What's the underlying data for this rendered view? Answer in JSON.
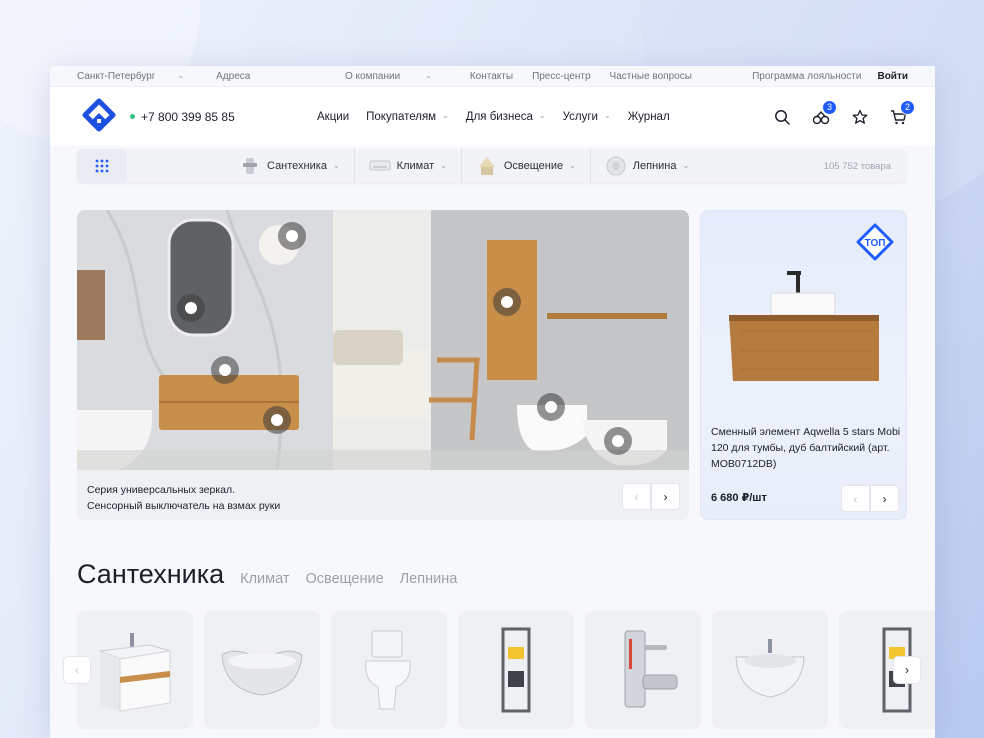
{
  "topbar": {
    "city": "Санкт-Петербург",
    "addresses": "Адреса",
    "links": [
      "О компании",
      "Контакты",
      "Пресс-центр",
      "Частные вопросы"
    ],
    "loyalty": "Программа лояльности",
    "login": "Войти"
  },
  "header": {
    "phone": "+7 800 399 85 85",
    "nav": [
      "Акции",
      "Покупателям",
      "Для бизнеса",
      "Услуги",
      "Журнал"
    ],
    "compare_count": "3",
    "cart_count": "2"
  },
  "categories": {
    "items": [
      "Сантехника",
      "Климат",
      "Освещение",
      "Лепнина"
    ],
    "total": "105 752 товара"
  },
  "hero": {
    "caption_line1": "Серия универсальных зеркал.",
    "caption_line2": "Сенсорный выключатель на взмах руки",
    "prev": "‹",
    "next": "›"
  },
  "promo": {
    "badge": "ТОП",
    "description": "Сменный элемент Aqwella 5 stars Mobi 120 для тумбы, дуб балтийский (арт. MOB0712DB)",
    "price": "6 680 ₽/шт",
    "prev": "‹",
    "next": "›"
  },
  "section": {
    "title": "Сантехника",
    "tabs": [
      "Климат",
      "Освещение",
      "Лепнина"
    ]
  },
  "carousel": {
    "prev": "‹",
    "next": "›"
  },
  "colors": {
    "accent": "#1f5bff",
    "brand": "#1d4fe0",
    "online": "#2ec27e"
  }
}
